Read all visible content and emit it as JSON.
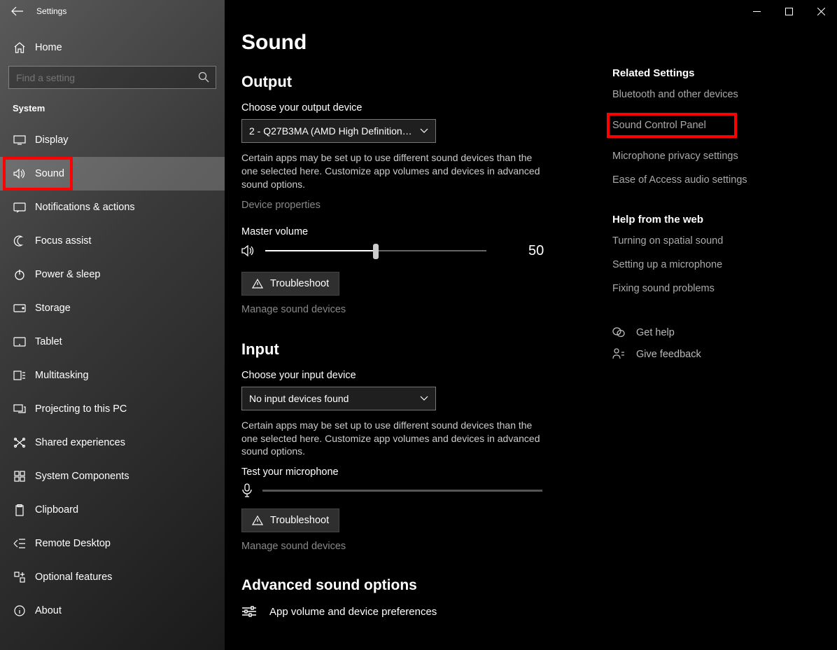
{
  "window": {
    "title": "Settings"
  },
  "sidebar": {
    "home": "Home",
    "search_placeholder": "Find a setting",
    "section": "System",
    "items": [
      {
        "label": "Display",
        "selected": false
      },
      {
        "label": "Sound",
        "selected": true
      },
      {
        "label": "Notifications & actions",
        "selected": false
      },
      {
        "label": "Focus assist",
        "selected": false
      },
      {
        "label": "Power & sleep",
        "selected": false
      },
      {
        "label": "Storage",
        "selected": false
      },
      {
        "label": "Tablet",
        "selected": false
      },
      {
        "label": "Multitasking",
        "selected": false
      },
      {
        "label": "Projecting to this PC",
        "selected": false
      },
      {
        "label": "Shared experiences",
        "selected": false
      },
      {
        "label": "System Components",
        "selected": false
      },
      {
        "label": "Clipboard",
        "selected": false
      },
      {
        "label": "Remote Desktop",
        "selected": false
      },
      {
        "label": "Optional features",
        "selected": false
      },
      {
        "label": "About",
        "selected": false
      }
    ]
  },
  "page": {
    "title": "Sound",
    "output": {
      "heading": "Output",
      "choose_label": "Choose your output device",
      "device": "2 - Q27B3MA (AMD High Definition…",
      "help": "Certain apps may be set up to use different sound devices than the one selected here. Customize app volumes and devices in advanced sound options.",
      "device_properties": "Device properties",
      "master_volume_label": "Master volume",
      "master_volume_value": "50",
      "master_volume_percent": 50,
      "troubleshoot": "Troubleshoot",
      "manage": "Manage sound devices"
    },
    "input": {
      "heading": "Input",
      "choose_label": "Choose your input device",
      "device": "No input devices found",
      "help": "Certain apps may be set up to use different sound devices than the one selected here. Customize app volumes and devices in advanced sound options.",
      "test_label": "Test your microphone",
      "troubleshoot": "Troubleshoot",
      "manage": "Manage sound devices"
    },
    "advanced": {
      "heading": "Advanced sound options",
      "item": "App volume and device preferences"
    }
  },
  "aside": {
    "related_heading": "Related Settings",
    "related": [
      "Bluetooth and other devices",
      "Sound Control Panel",
      "Microphone privacy settings",
      "Ease of Access audio settings"
    ],
    "help_heading": "Help from the web",
    "help_links": [
      "Turning on spatial sound",
      "Setting up a microphone",
      "Fixing sound problems"
    ],
    "get_help": "Get help",
    "give_feedback": "Give feedback"
  }
}
